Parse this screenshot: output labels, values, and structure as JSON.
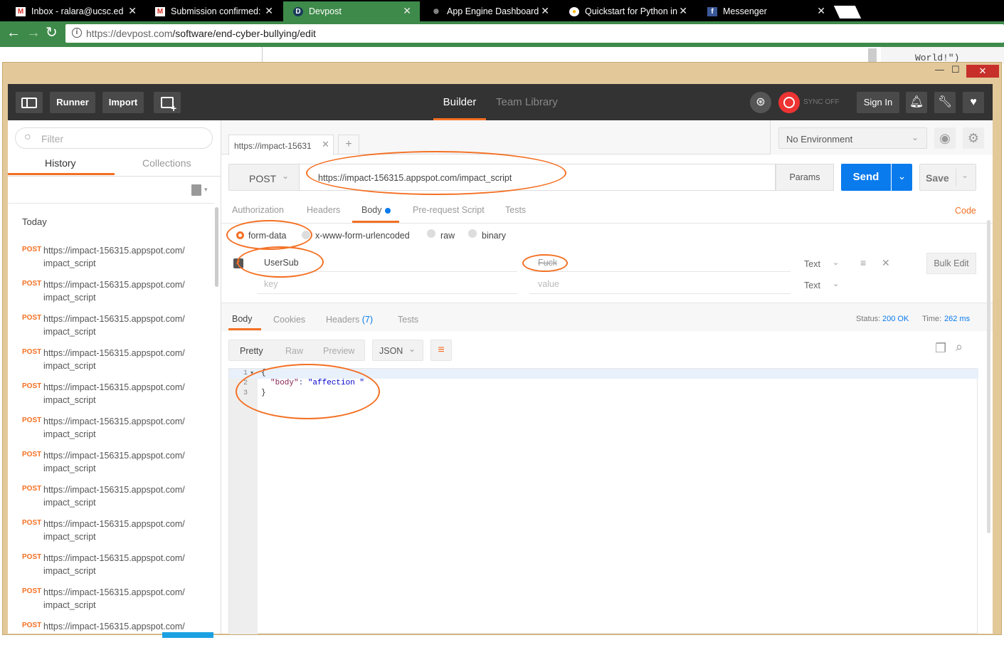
{
  "browser": {
    "tabs": [
      {
        "icon": "gmail-icon",
        "title": "Inbox - ralara@ucsc.edu"
      },
      {
        "icon": "gmail-icon",
        "title": "Submission confirmed: E"
      },
      {
        "icon": "devpost-icon",
        "title": "Devpost"
      },
      {
        "icon": "appengine-icon",
        "title": "App Engine Dashboard -"
      },
      {
        "icon": "chrome-icon",
        "title": "Quickstart for Python in"
      },
      {
        "icon": "facebook-icon",
        "title": "Messenger"
      }
    ],
    "url_host": "https://devpost.com",
    "url_path": "/software/end-cyber-bullying/edit",
    "behind_code": "World!\")"
  },
  "toolbar": {
    "runner": "Runner",
    "import": "Import",
    "builder": "Builder",
    "team_library": "Team Library",
    "sync": "SYNC OFF",
    "sign_in": "Sign In"
  },
  "sidebar": {
    "filter_placeholder": "Filter",
    "tabs": [
      "History",
      "Collections"
    ],
    "today": "Today",
    "items": [
      {
        "method": "POST",
        "line1": "https://impact-156315.appspot.com/",
        "line2": "impact_script"
      },
      {
        "method": "POST",
        "line1": "https://impact-156315.appspot.com/",
        "line2": "impact_script"
      },
      {
        "method": "POST",
        "line1": "https://impact-156315.appspot.com/",
        "line2": "impact_script"
      },
      {
        "method": "POST",
        "line1": "https://impact-156315.appspot.com/",
        "line2": "impact_script"
      },
      {
        "method": "POST",
        "line1": "https://impact-156315.appspot.com/",
        "line2": "impact_script"
      },
      {
        "method": "POST",
        "line1": "https://impact-156315.appspot.com/",
        "line2": "impact_script"
      },
      {
        "method": "POST",
        "line1": "https://impact-156315.appspot.com/",
        "line2": "impact_script"
      },
      {
        "method": "POST",
        "line1": "https://impact-156315.appspot.com/",
        "line2": "impact_script"
      },
      {
        "method": "POST",
        "line1": "https://impact-156315.appspot.com/",
        "line2": "impact_script"
      },
      {
        "method": "POST",
        "line1": "https://impact-156315.appspot.com/",
        "line2": "impact_script"
      },
      {
        "method": "POST",
        "line1": "https://impact-156315.appspot.com/",
        "line2": "impact_script"
      },
      {
        "method": "POST",
        "line1": "https://impact-156315.appspot.com/",
        "line2": ""
      }
    ]
  },
  "request": {
    "tab_label": "https://impact-15631",
    "environment": "No Environment",
    "method": "POST",
    "url": "https://impact-156315.appspot.com/impact_script",
    "params": "Params",
    "send": "Send",
    "save": "Save",
    "subtabs": [
      "Authorization",
      "Headers",
      "Body",
      "Pre-request Script",
      "Tests"
    ],
    "code": "Code",
    "body_types": [
      "form-data",
      "x-www-form-urlencoded",
      "raw",
      "binary"
    ],
    "row_key": "UserSub",
    "row_value": "Fuck",
    "row_type": "Text",
    "key_placeholder": "key",
    "value_placeholder": "value",
    "bulk_edit": "Bulk Edit"
  },
  "response": {
    "tabs": [
      "Body",
      "Cookies",
      "Headers",
      "(7)",
      "Tests"
    ],
    "status_label": "Status:",
    "status_value": "200 OK",
    "time_label": "Time:",
    "time_value": "262 ms",
    "view_modes": [
      "Pretty",
      "Raw",
      "Preview"
    ],
    "format": "JSON",
    "lines": [
      "1",
      "2",
      "3"
    ],
    "code_open": "{",
    "code_key": "\"body\"",
    "code_colon": ": ",
    "code_value": "\"affection \"",
    "code_close": "}"
  }
}
